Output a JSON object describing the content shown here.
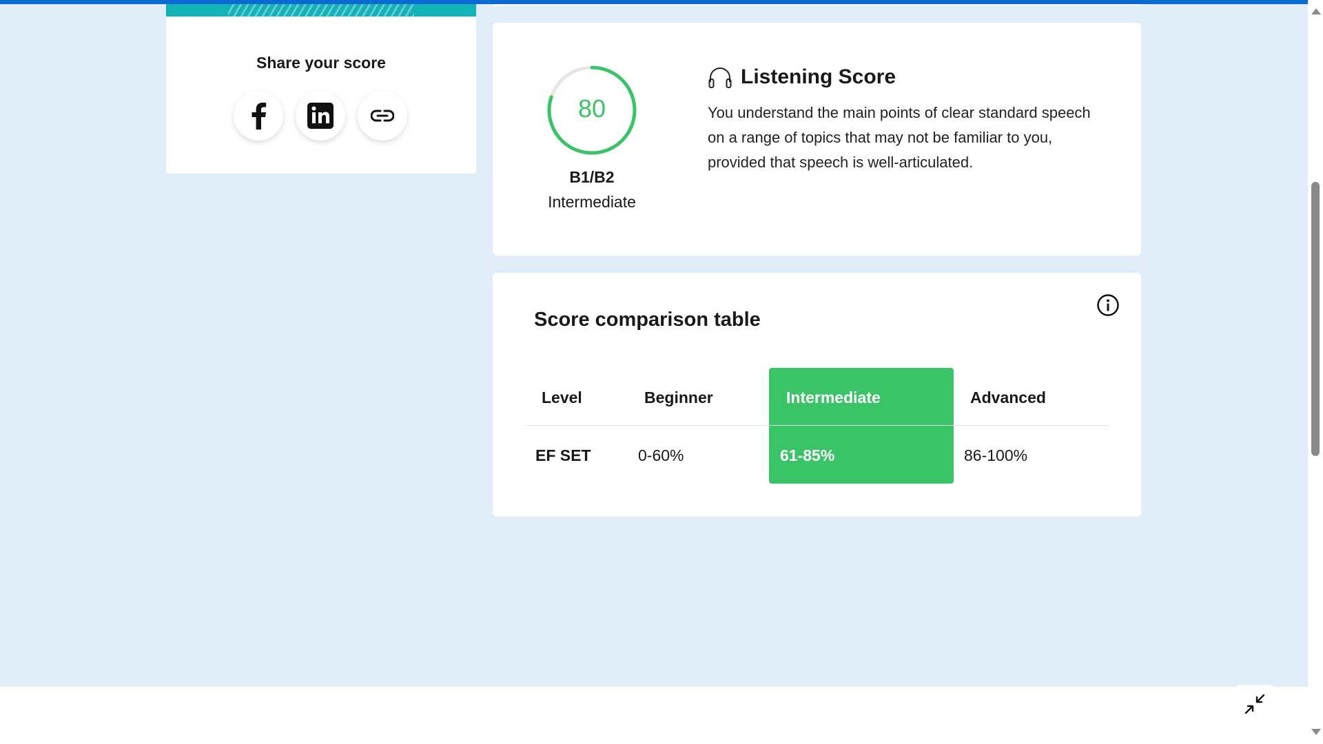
{
  "share": {
    "title": "Share your score",
    "buttons": [
      {
        "icon": "facebook-icon"
      },
      {
        "icon": "linkedin-icon"
      },
      {
        "icon": "link-icon"
      }
    ]
  },
  "listening": {
    "score": "80",
    "score_fraction": 0.8,
    "level_code": "B1/B2",
    "level_name": "Intermediate",
    "title": "Listening Score",
    "icon": "headphones-icon",
    "description": "You understand the main points of clear standard speech on a range of topics that may not be familiar to you, provided that speech is well-articulated."
  },
  "comparison": {
    "title": "Score comparison table",
    "headers": [
      "Level",
      "Beginner",
      "Intermediate",
      "Advanced"
    ],
    "row": [
      "EF SET",
      "0-60%",
      "61-85%",
      "86-100%"
    ],
    "highlighted_column": "Intermediate"
  },
  "colors": {
    "accent_green": "#3ac467",
    "top_bar": "#0a6ad4",
    "teal_stripe": "#13b1b8",
    "page_bg": "#e0edf9"
  }
}
